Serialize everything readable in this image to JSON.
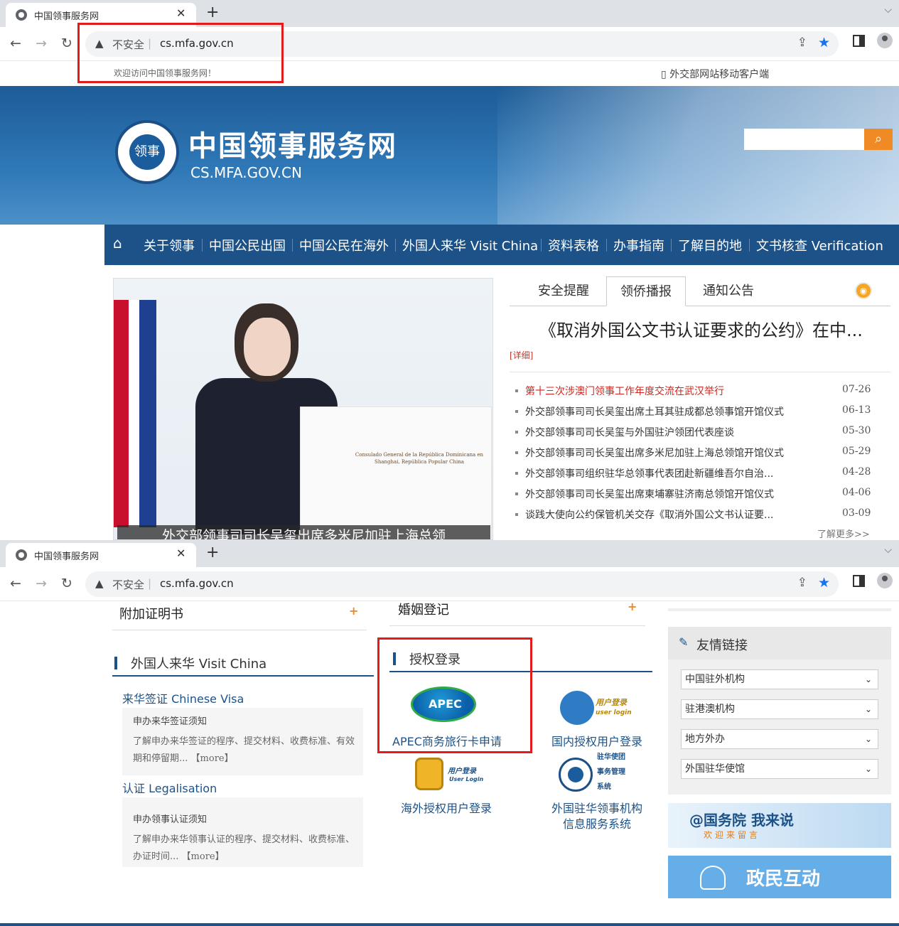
{
  "browser": {
    "tab_title": "中国领事服务网",
    "tab_close": "✕",
    "new_tab": "+",
    "insecure_label": "不安全",
    "url": "cs.mfa.gov.cn"
  },
  "site": {
    "welcome": "欢迎访问中国领事服务网！",
    "mobile_client": "外交部网站移动客户端",
    "name_cn": "中国领事服务网",
    "name_en": "CS.MFA.GOV.CN",
    "seal_text": "领事"
  },
  "nav": {
    "items": [
      "关于领事",
      "中国公民出国",
      "中国公民在海外",
      "外国人来华 Visit China",
      "资料表格",
      "办事指南",
      "了解目的地",
      "文书核查 Verification"
    ]
  },
  "slider": {
    "caption": "外交部领事司司长吴玺出席多米尼加驻上海总领",
    "podium_text": "Consulado General de la República Dominicana en Shanghai, República Popular China"
  },
  "news_tabs": [
    "安全提醒",
    "领侨播报",
    "通知公告"
  ],
  "headline": "《取消外国公文书认证要求的公约》在中...",
  "detail_link": "[详细]",
  "news": [
    {
      "title": "第十三次涉澳门领事工作年度交流在武汉举行",
      "date": "07-26"
    },
    {
      "title": "外交部领事司司长吴玺出席土耳其驻成都总领事馆开馆仪式",
      "date": "06-13"
    },
    {
      "title": "外交部领事司司长吴玺与外国驻沪领团代表座谈",
      "date": "05-30"
    },
    {
      "title": "外交部领事司司长吴玺出席多米尼加驻上海总领馆开馆仪式",
      "date": "05-29"
    },
    {
      "title": "外交部领事司组织驻华总领事代表团赴新疆维吾尔自治...",
      "date": "04-28"
    },
    {
      "title": "外交部领事司司长吴玺出席柬埔寨驻济南总领馆开馆仪式",
      "date": "04-06"
    },
    {
      "title": "谈践大使向公约保管机关交存《取消外国公文书认证要...",
      "date": "03-09"
    }
  ],
  "more_link": "了解更多>>",
  "lower": {
    "fujia": "附加证明书",
    "hunyin": "婚姻登记",
    "visit_title": "外国人来华 Visit China",
    "visa_link": "来华签证 Chinese Visa",
    "visa_box_title": "申办来华签证须知",
    "visa_box_text": "了解申办来华签证的程序、提交材料、收费标准、有效期和停留期...",
    "more_tag": "【more】",
    "legal_link": "认证 Legalisation",
    "legal_box_title": "申办领事认证须知",
    "legal_box_text": "了解申办来华领事认证的程序、提交材料、收费标准、办证时间...",
    "auth_title": "授权登录",
    "apec_label": "APEC商务旅行卡申请",
    "apec_logo": "APEC",
    "domestic_label": "国内授权用户登录",
    "user_login_cn": "用户登录",
    "user_login_en": "user login",
    "overseas_label": "海外授权用户登录",
    "user_login2_en": "User Login",
    "foreign_label_1": "外国驻华领事机构",
    "foreign_label_2": "信息服务系统",
    "foreign_icon_text": [
      "驻华使团",
      "事务管理",
      "系统"
    ]
  },
  "friend_links": {
    "title": "友情链接",
    "selects": [
      "中国驻外机构",
      "驻港澳机构",
      "地方外办",
      "外国驻华使馆"
    ]
  },
  "banners": {
    "guowuyuan": "@国务院 我来说",
    "guowuyuan_sub": "欢迎来留言",
    "zhengmin": "政民互动"
  }
}
